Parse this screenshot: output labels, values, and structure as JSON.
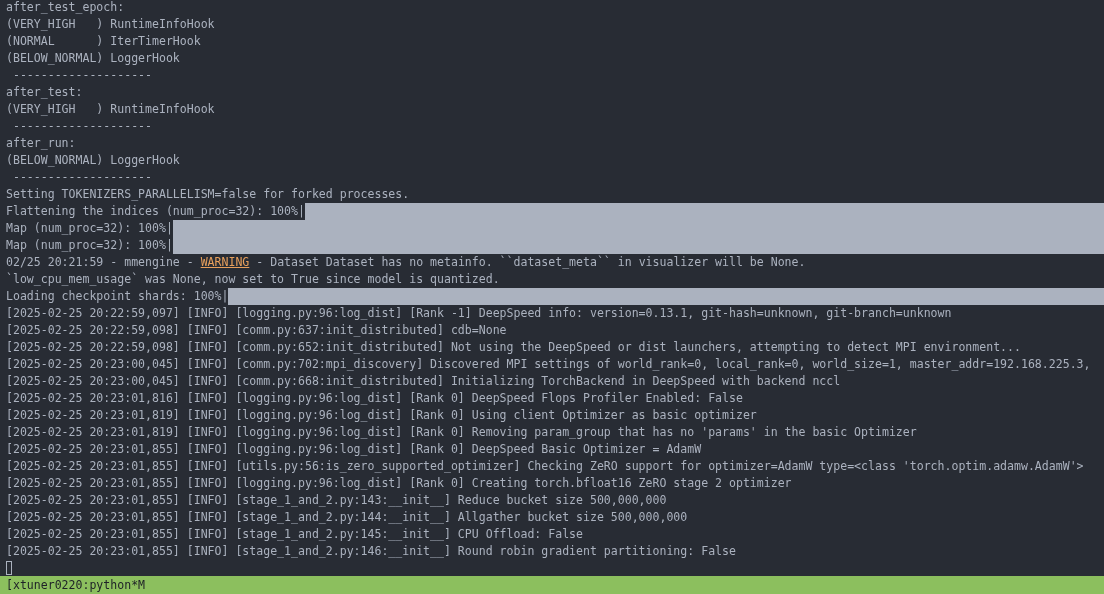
{
  "terminal": {
    "lines": [
      {
        "kind": "text",
        "text": "after_test_epoch:"
      },
      {
        "kind": "text",
        "text": "(VERY_HIGH   ) RuntimeInfoHook"
      },
      {
        "kind": "text",
        "text": "(NORMAL      ) IterTimerHook"
      },
      {
        "kind": "text",
        "text": "(BELOW_NORMAL) LoggerHook"
      },
      {
        "kind": "text",
        "text": " --------------------"
      },
      {
        "kind": "text",
        "text": "after_test:"
      },
      {
        "kind": "text",
        "text": "(VERY_HIGH   ) RuntimeInfoHook"
      },
      {
        "kind": "text",
        "text": " --------------------"
      },
      {
        "kind": "text",
        "text": "after_run:"
      },
      {
        "kind": "text",
        "text": "(BELOW_NORMAL) LoggerHook"
      },
      {
        "kind": "text",
        "text": " --------------------"
      },
      {
        "kind": "text",
        "text": "Setting TOKENIZERS_PARALLELISM=false for forked processes."
      },
      {
        "kind": "progress",
        "label": "Flattening the indices (num_proc=32): 100%|",
        "level": 1
      },
      {
        "kind": "progress",
        "label": "Map (num_proc=32): 100%|",
        "level": 1
      },
      {
        "kind": "progress",
        "label": "Map (num_proc=32): 100%|",
        "level": 1
      },
      {
        "kind": "warning",
        "prefix": "02/25 20:21:59 - mmengine - ",
        "tag": "WARNING",
        "message": " - Dataset Dataset has no metainfo. ``dataset_meta`` in visualizer will be None."
      },
      {
        "kind": "text",
        "text": "`low_cpu_mem_usage` was None, now set to True since model is quantized."
      },
      {
        "kind": "progress",
        "label": "Loading checkpoint shards: 100%|",
        "level": 1
      },
      {
        "kind": "text",
        "text": "[2025-02-25 20:22:59,097] [INFO] [logging.py:96:log_dist] [Rank -1] DeepSpeed info: version=0.13.1, git-hash=unknown, git-branch=unknown"
      },
      {
        "kind": "text",
        "text": "[2025-02-25 20:22:59,098] [INFO] [comm.py:637:init_distributed] cdb=None"
      },
      {
        "kind": "text",
        "text": "[2025-02-25 20:22:59,098] [INFO] [comm.py:652:init_distributed] Not using the DeepSpeed or dist launchers, attempting to detect MPI environment..."
      },
      {
        "kind": "text",
        "text": "[2025-02-25 20:23:00,045] [INFO] [comm.py:702:mpi_discovery] Discovered MPI settings of world_rank=0, local_rank=0, world_size=1, master_addr=192.168.225.3,"
      },
      {
        "kind": "text",
        "text": "[2025-02-25 20:23:00,045] [INFO] [comm.py:668:init_distributed] Initializing TorchBackend in DeepSpeed with backend nccl"
      },
      {
        "kind": "text",
        "text": "[2025-02-25 20:23:01,816] [INFO] [logging.py:96:log_dist] [Rank 0] DeepSpeed Flops Profiler Enabled: False"
      },
      {
        "kind": "text",
        "text": "[2025-02-25 20:23:01,819] [INFO] [logging.py:96:log_dist] [Rank 0] Using client Optimizer as basic optimizer"
      },
      {
        "kind": "text",
        "text": "[2025-02-25 20:23:01,819] [INFO] [logging.py:96:log_dist] [Rank 0] Removing param_group that has no 'params' in the basic Optimizer"
      },
      {
        "kind": "text",
        "text": "[2025-02-25 20:23:01,855] [INFO] [logging.py:96:log_dist] [Rank 0] DeepSpeed Basic Optimizer = AdamW"
      },
      {
        "kind": "text",
        "text": "[2025-02-25 20:23:01,855] [INFO] [utils.py:56:is_zero_supported_optimizer] Checking ZeRO support for optimizer=AdamW type=<class 'torch.optim.adamw.AdamW'>"
      },
      {
        "kind": "text",
        "text": "[2025-02-25 20:23:01,855] [INFO] [logging.py:96:log_dist] [Rank 0] Creating torch.bfloat16 ZeRO stage 2 optimizer"
      },
      {
        "kind": "text",
        "text": "[2025-02-25 20:23:01,855] [INFO] [stage_1_and_2.py:143:__init__] Reduce bucket size 500,000,000"
      },
      {
        "kind": "text",
        "text": "[2025-02-25 20:23:01,855] [INFO] [stage_1_and_2.py:144:__init__] Allgather bucket size 500,000,000"
      },
      {
        "kind": "text",
        "text": "[2025-02-25 20:23:01,855] [INFO] [stage_1_and_2.py:145:__init__] CPU Offload: False"
      },
      {
        "kind": "text",
        "text": "[2025-02-25 20:23:01,855] [INFO] [stage_1_and_2.py:146:__init__] Round robin gradient partitioning: False"
      },
      {
        "kind": "cursor"
      }
    ]
  },
  "status_bar": {
    "text": "[xtuner0220:python*M"
  }
}
